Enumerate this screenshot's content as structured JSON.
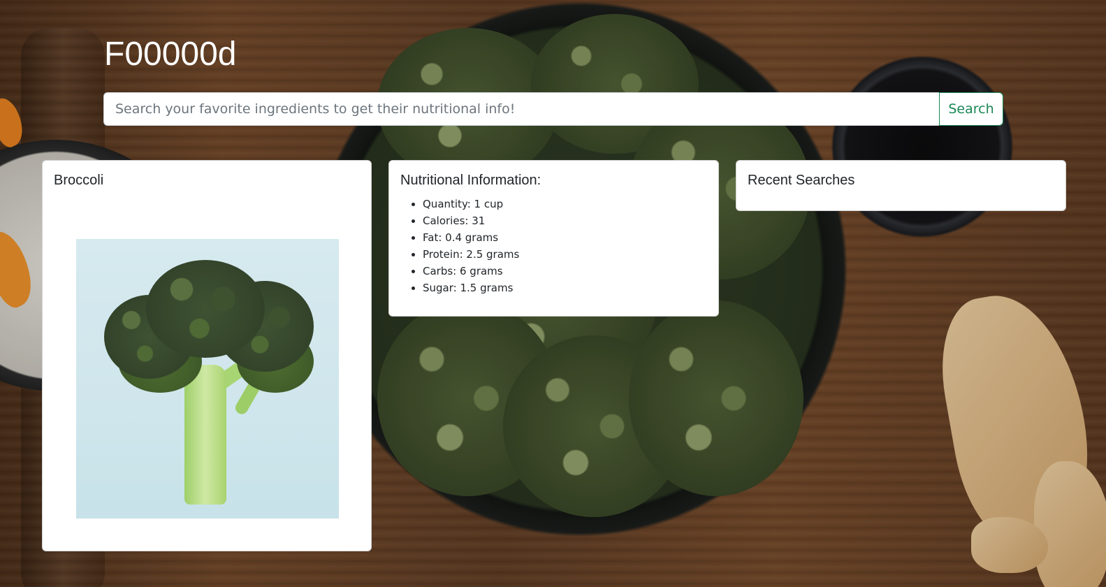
{
  "app": {
    "brand": "F00000d"
  },
  "search": {
    "placeholder": "Search your favorite ingredients to get their nutritional info!",
    "value": "",
    "button_label": "Search"
  },
  "ingredient_card": {
    "title": "Broccoli",
    "image_subject": "broccoli-photo"
  },
  "nutrition_card": {
    "title": "Nutritional Information:",
    "items": [
      "Quantity: 1 cup",
      "Calories: 31",
      "Fat: 0.4 grams",
      "Protein: 2.5 grams",
      "Carbs: 6 grams",
      "Sugar: 1.5 grams"
    ]
  },
  "recent_card": {
    "title": "Recent Searches",
    "items": []
  },
  "colors": {
    "accent": "#198754",
    "card_bg": "#ffffff",
    "text": "#212529",
    "placeholder": "#6c757d"
  }
}
